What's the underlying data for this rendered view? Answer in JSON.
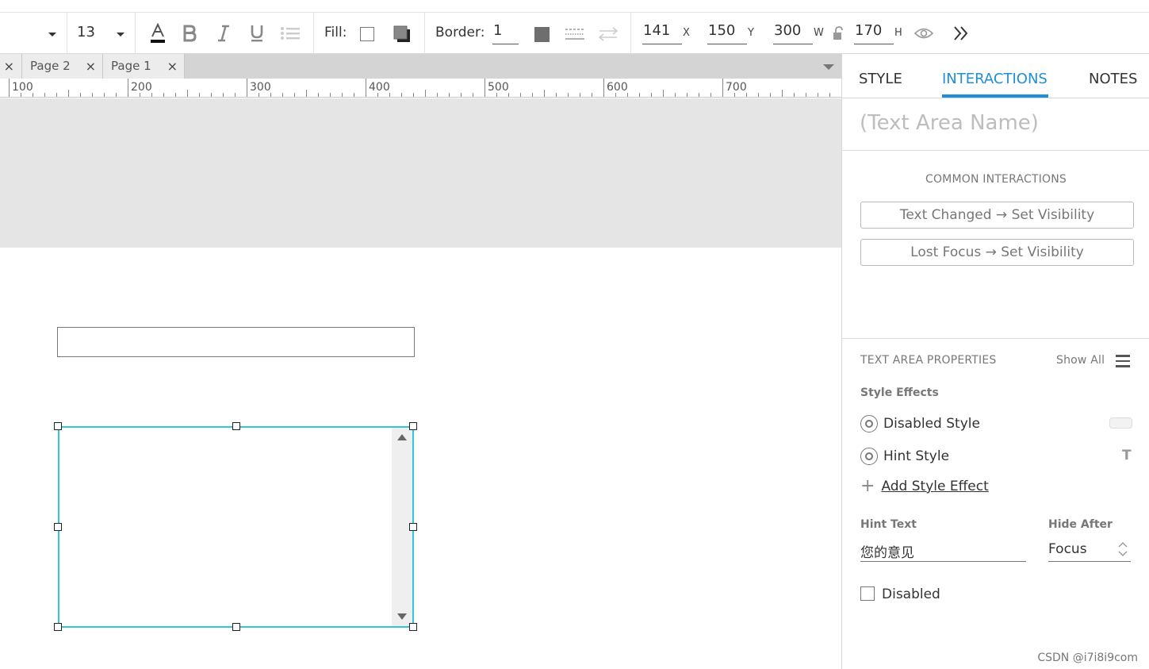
{
  "toolbar": {
    "font_size": "13",
    "fill_label": "Fill:",
    "border_label": "Border:",
    "border_value": "1",
    "x_value": "141",
    "x_label": "X",
    "y_value": "150",
    "y_label": "Y",
    "w_value": "300",
    "w_label": "W",
    "h_value": "170",
    "h_label": "H",
    "icons": [
      "font-color-icon",
      "bold-icon",
      "italic-icon",
      "underline-icon",
      "bullet-list-icon",
      "fill-color-icon",
      "fill-shadow-icon",
      "border-color-icon",
      "border-style-icon",
      "arrow-style-icon",
      "lock-icon",
      "visibility-icon",
      "expand-icon"
    ]
  },
  "page_tabs": [
    {
      "label": "Page 2"
    },
    {
      "label": "Page 1"
    }
  ],
  "ruler": {
    "marks": [
      "100",
      "200",
      "300",
      "400",
      "500",
      "600",
      "700"
    ]
  },
  "panel": {
    "tabs": {
      "style": "STYLE",
      "interactions": "INTERACTIONS",
      "notes": "NOTES"
    },
    "active_tab": "INTERACTIONS",
    "name_placeholder": "(Text Area Name)",
    "common_interactions_title": "COMMON INTERACTIONS",
    "interaction_buttons": [
      "Text Changed → Set Visibility",
      "Lost Focus → Set Visibility"
    ],
    "properties_title": "TEXT AREA PROPERTIES",
    "show_all": "Show All",
    "style_effects_title": "Style Effects",
    "disabled_style": "Disabled Style",
    "hint_style": "Hint Style",
    "hint_style_glyph": "T",
    "add_style_effect": "Add Style Effect",
    "hint_text_label": "Hint Text",
    "hint_text_value": "您的意见",
    "hide_after_label": "Hide After",
    "hide_after_value": "Focus",
    "disabled_label": "Disabled",
    "disabled_checked": false
  },
  "watermark": "CSDN @i7i8i9com",
  "colors": {
    "accent": "#1e8fd8",
    "selection": "#35c5d8",
    "canvas_band": "#e5e5e5"
  }
}
